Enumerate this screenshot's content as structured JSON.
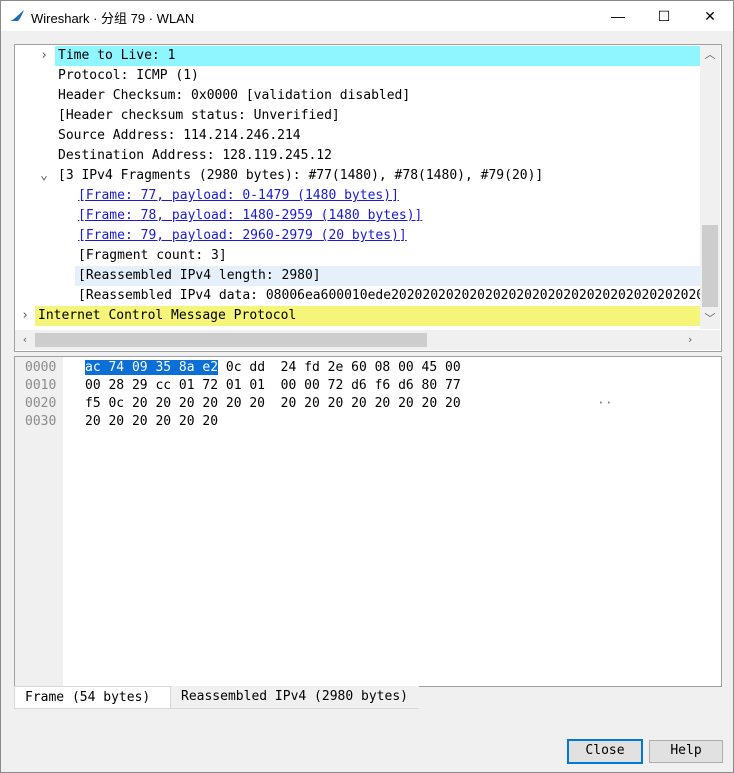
{
  "window": {
    "title": "Wireshark · 分组 79 · WLAN",
    "min_glyph": "—",
    "max_glyph": "☐",
    "close_glyph": "✕"
  },
  "tree": {
    "rows": [
      {
        "text": "Time to Live: 1"
      },
      {
        "text": "Protocol: ICMP (1)"
      },
      {
        "text": "Header Checksum: 0x0000 [validation disabled]"
      },
      {
        "text": "[Header checksum status: Unverified]"
      },
      {
        "text": "Source Address: 114.214.246.214"
      },
      {
        "text": "Destination Address: 128.119.245.12"
      },
      {
        "text": "[3 IPv4 Fragments (2980 bytes): #77(1480), #78(1480), #79(20)]"
      },
      {
        "text": "[Frame: 77, payload: 0-1479 (1480 bytes)]"
      },
      {
        "text": "[Frame: 78, payload: 1480-2959 (1480 bytes)]"
      },
      {
        "text": "[Frame: 79, payload: 2960-2979 (20 bytes)]"
      },
      {
        "text": "[Fragment count: 3]"
      },
      {
        "text": "[Reassembled IPv4 length: 2980]"
      },
      {
        "text": "[Reassembled IPv4 data: 08006ea600010ede2020202020202020202020202020202020202020"
      },
      {
        "text": "Internet Control Message Protocol"
      }
    ],
    "highlight_ttl": "#8ff5ff",
    "highlight_icmp": "#f5f57a",
    "highlight_row": "#e6f0fa"
  },
  "hex": {
    "lines": [
      {
        "offset": "0000",
        "selected": "ac 74 09 35 8a e2",
        "rest": " 0c dd  24 fd 2e 60 08 00 45 00",
        "ascii": ""
      },
      {
        "offset": "0010",
        "selected": "",
        "rest": "00 28 29 cc 01 72 01 01  00 00 72 d6 f6 d6 80 77",
        "ascii": ""
      },
      {
        "offset": "0020",
        "selected": "",
        "rest": "f5 0c 20 20 20 20 20 20  20 20 20 20 20 20 20 20",
        "ascii": "··"
      },
      {
        "offset": "0030",
        "selected": "",
        "rest": "20 20 20 20 20 20",
        "ascii": ""
      }
    ]
  },
  "tabs": [
    "Frame (54 bytes)",
    "Reassembled IPv4 (2980 bytes)"
  ],
  "buttons": {
    "close": "Close",
    "help": "Help"
  }
}
